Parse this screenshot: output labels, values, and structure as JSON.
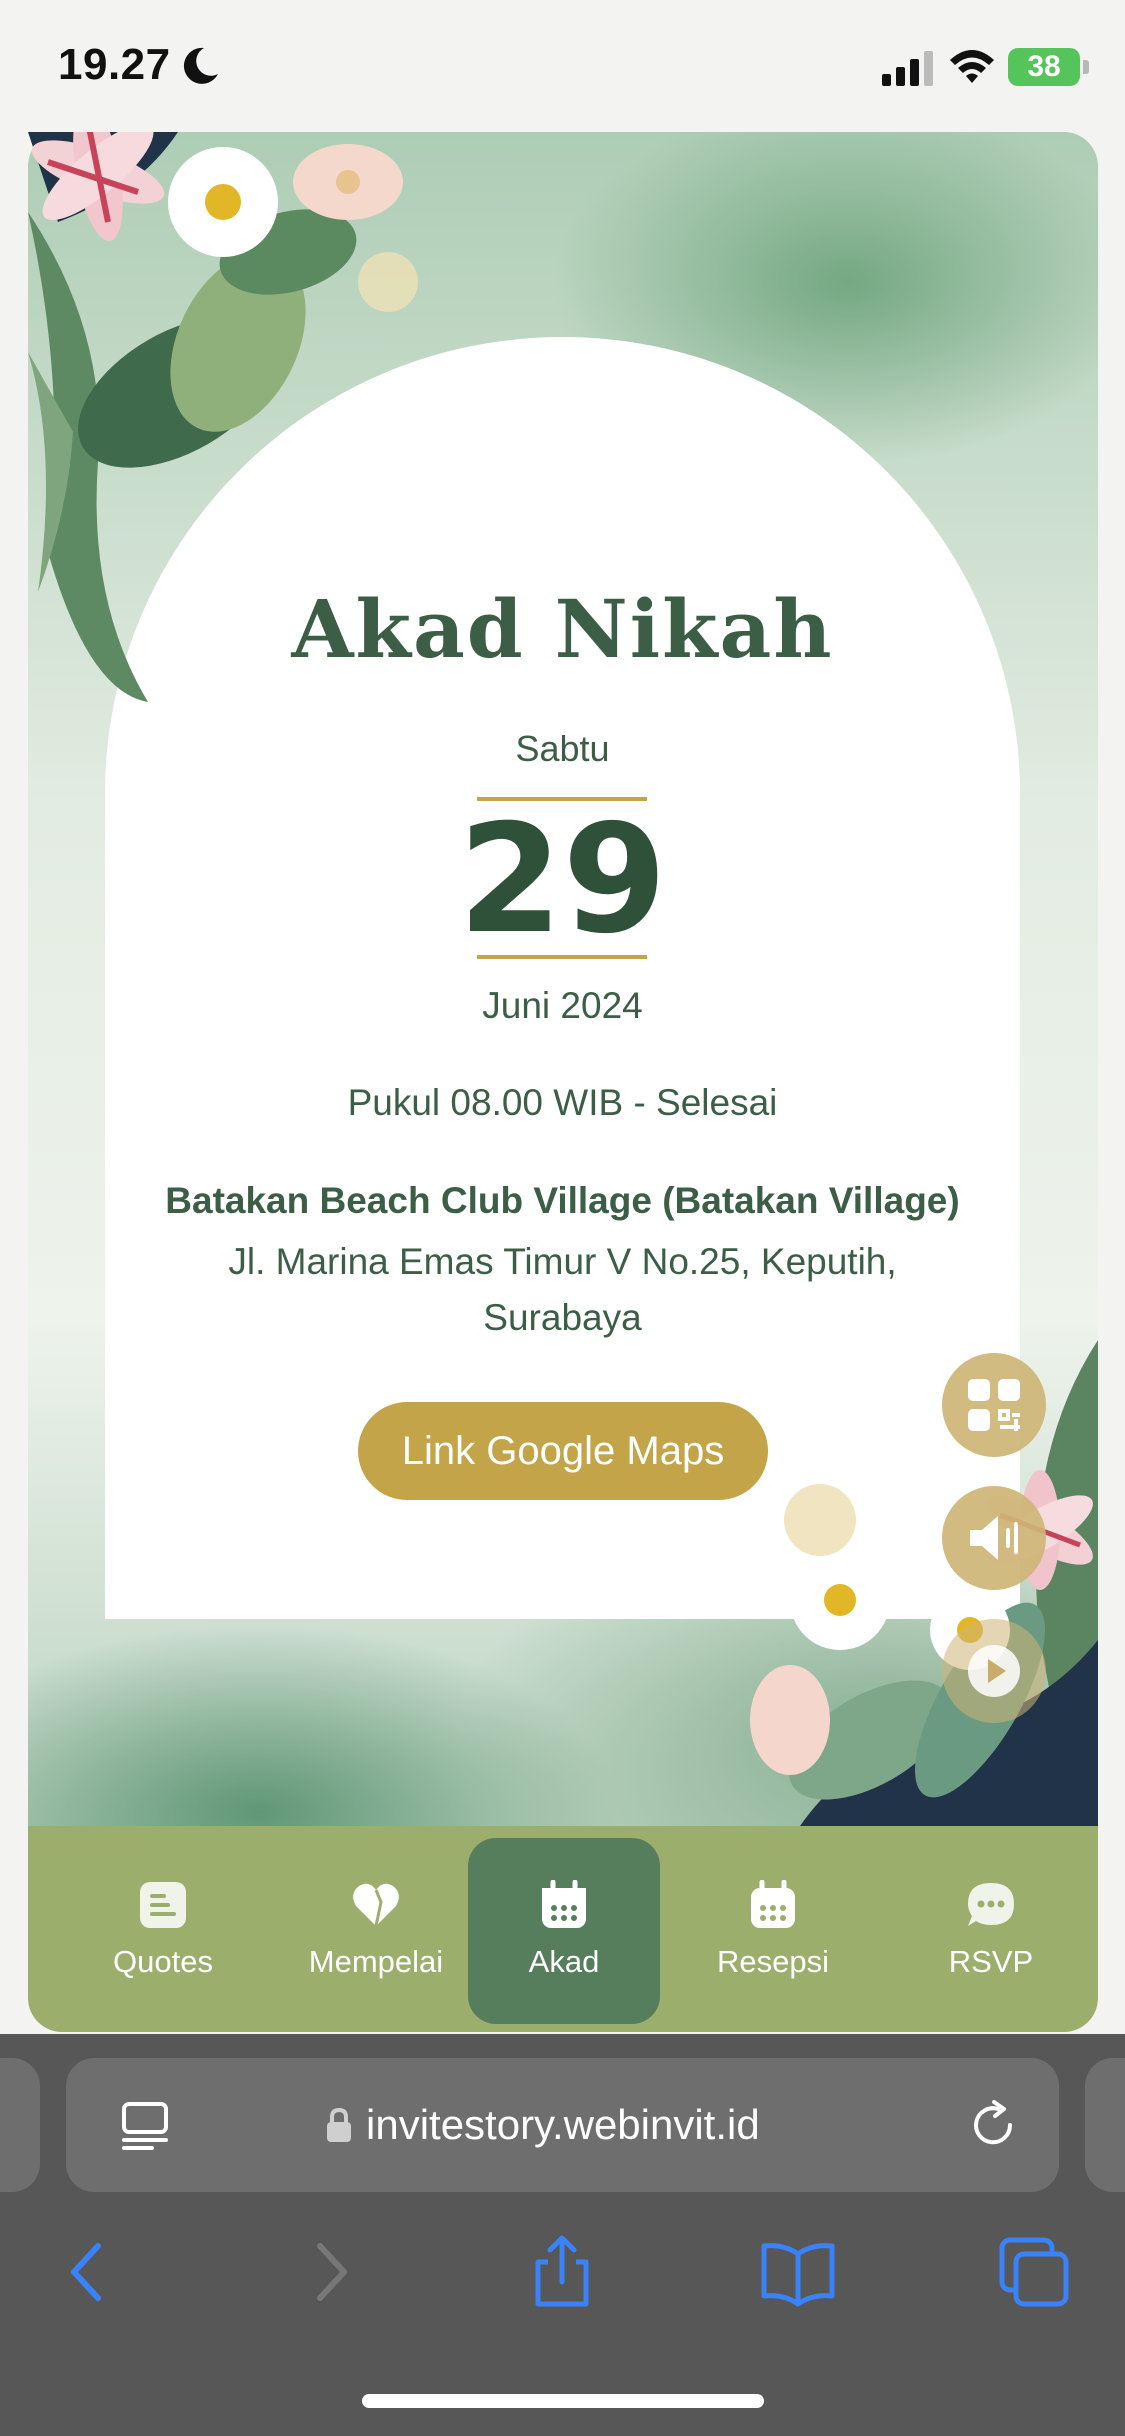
{
  "status_bar": {
    "time": "19.27",
    "battery": "38"
  },
  "event": {
    "title": "Akad Nikah",
    "day": "Sabtu",
    "date": "29",
    "month_year": "Juni 2024",
    "time_range": "Pukul 08.00 WIB - Selesai",
    "venue": "Batakan Beach Club Village (Batakan Village)",
    "address": "Jl. Marina Emas Timur V No.25, Keputih, Surabaya",
    "maps_button": "Link Google Maps"
  },
  "floating_actions": [
    "qr-code-icon",
    "speaker-icon",
    "play-icon"
  ],
  "nav": {
    "items": [
      {
        "label": "Quotes",
        "icon": "quote-doc-icon"
      },
      {
        "label": "Mempelai",
        "icon": "heart-icon"
      },
      {
        "label": "Akad",
        "icon": "calendar-icon",
        "active": true
      },
      {
        "label": "Resepsi",
        "icon": "calendar-icon"
      },
      {
        "label": "RSVP",
        "icon": "chat-bubble-icon"
      }
    ]
  },
  "browser": {
    "url": "invitestory.webinvit.id"
  },
  "colors": {
    "primary_text": "#3d5e46",
    "gold": "#c4a448",
    "nav_bg": "#9cae6c",
    "nav_active": "#567d5c",
    "browser_bg": "#575757",
    "browser_accent": "#3a82f7"
  }
}
